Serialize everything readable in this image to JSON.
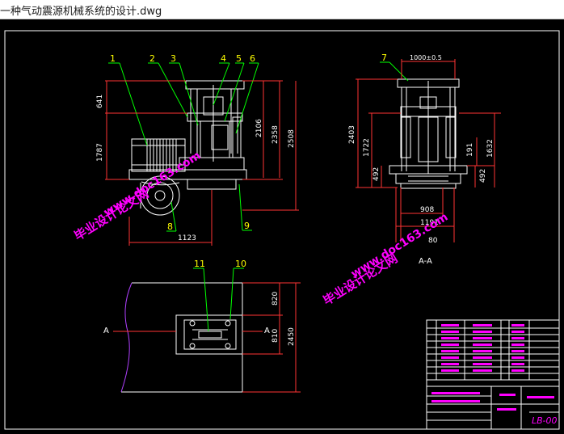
{
  "window": {
    "title": "一种气动震源机械系统的设计.dwg"
  },
  "colors": {
    "background": "#000000",
    "border": "#ffffff",
    "leader": "#00ff00",
    "dim": "#ff3333",
    "part": "#ffffff",
    "label": "#ffff00",
    "watermark": "#ff00ff"
  },
  "front_view": {
    "balloons": [
      "1",
      "2",
      "3",
      "4",
      "5",
      "6",
      "8",
      "9"
    ],
    "dims": {
      "d641": "641",
      "d1787": "1787",
      "d2106": "2106",
      "d2358": "2358",
      "d2508": "2508",
      "d1123": "1123"
    }
  },
  "side_view": {
    "balloons": [
      "7"
    ],
    "dims": {
      "d1000": "1000±0.5",
      "d2403": "2403",
      "d1722": "1722",
      "d191": "191",
      "d1632": "1632",
      "d492a": "492",
      "d492b": "492",
      "d908": "908",
      "d1191": "1191",
      "d80": "80"
    },
    "section_label": "A-A"
  },
  "plan_view": {
    "balloons": [
      "11",
      "10"
    ],
    "dims": {
      "d820": "820",
      "d810": "810",
      "d2450": "2450"
    },
    "cut_left": "A",
    "cut_right": "A"
  },
  "title_block": {
    "drawing_no": "LB-00"
  },
  "watermarks": [
    {
      "text": "毕业设计论文网"
    },
    {
      "text": "www.doc163.com"
    },
    {
      "text": "毕业设计论文网"
    },
    {
      "text": "www.doc163.com"
    }
  ]
}
